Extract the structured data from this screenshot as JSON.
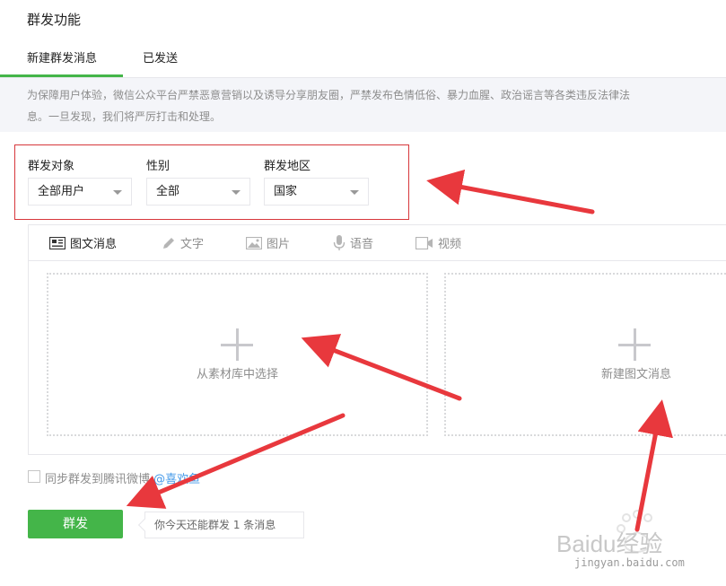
{
  "page": {
    "title": "群发功能"
  },
  "tabs": [
    {
      "label": "新建群发消息",
      "active": true
    },
    {
      "label": "已发送",
      "active": false
    }
  ],
  "notice": {
    "line1": "为保障用户体验，微信公众平台严禁恶意营销以及诱导分享朋友圈，严禁发布色情低俗、暴力血腥、政治谣言等各类违反法律法",
    "line2": "息。一旦发现，我们将严厉打击和处理。"
  },
  "filters": {
    "target": {
      "label": "群发对象",
      "value": "全部用户"
    },
    "gender": {
      "label": "性别",
      "value": "全部"
    },
    "region": {
      "label": "群发地区",
      "value": "国家"
    }
  },
  "editor_tabs": [
    {
      "label": "图文消息",
      "icon": "news-icon",
      "active": true
    },
    {
      "label": "文字",
      "icon": "pencil-icon",
      "active": false
    },
    {
      "label": "图片",
      "icon": "image-icon",
      "active": false
    },
    {
      "label": "语音",
      "icon": "microphone-icon",
      "active": false
    },
    {
      "label": "视频",
      "icon": "video-icon",
      "active": false
    }
  ],
  "cards": {
    "from_library": "从素材库中选择",
    "new_news": "新建图文消息"
  },
  "sync": {
    "label": "同步群发到腾讯微博",
    "account": "@喜欢鱼",
    "checked": false
  },
  "send_button": "群发",
  "quota_tip": "你今天还能群发 1 条消息",
  "watermark": {
    "brand": "Baidu经验",
    "url": "jingyan.baidu.com"
  },
  "colors": {
    "accent": "#44b549",
    "annotation_red": "#e8383d",
    "link": "#459ae9"
  }
}
